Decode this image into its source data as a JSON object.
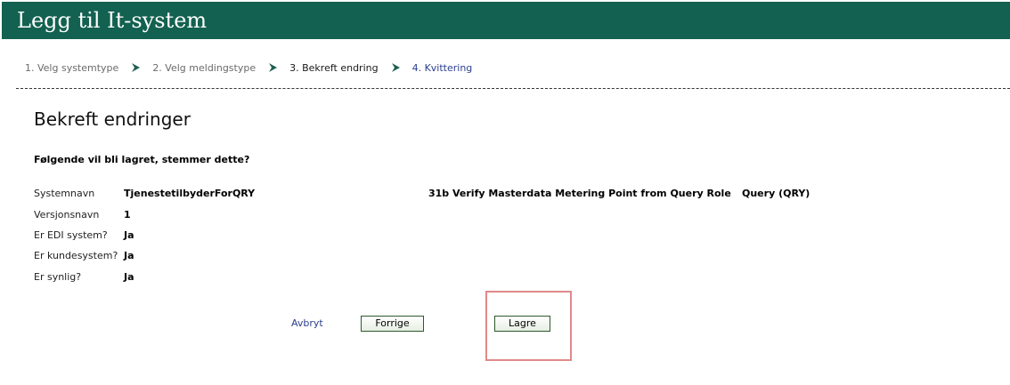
{
  "header": {
    "title": "Legg til It-system"
  },
  "steps": [
    {
      "label": "1. Velg systemtype"
    },
    {
      "label": "2. Velg meldingstype"
    },
    {
      "label": "3. Bekreft endring"
    },
    {
      "label": "4. Kvittering"
    }
  ],
  "page": {
    "title": "Bekreft endringer",
    "question": "Følgende vil bli lagret, stemmer dette?"
  },
  "fields": [
    {
      "label": "Systemnavn",
      "value": "TjenestetilbyderForQRY"
    },
    {
      "label": "Versjonsnavn",
      "value": "1"
    },
    {
      "label": "Er EDI system?",
      "value": "Ja"
    },
    {
      "label": "Er kundesystem?",
      "value": "Ja"
    },
    {
      "label": "Er synlig?",
      "value": "Ja"
    }
  ],
  "message": {
    "name": "31b Verify Masterdata Metering Point from Query Role",
    "role": "Query (QRY)"
  },
  "actions": {
    "cancel": "Avbryt",
    "previous": "Forrige",
    "save": "Lagre"
  },
  "colors": {
    "header_bg": "#136150",
    "arrow": "#1f5f50",
    "link": "#2a3f8f",
    "highlight": "#e08a8a"
  }
}
